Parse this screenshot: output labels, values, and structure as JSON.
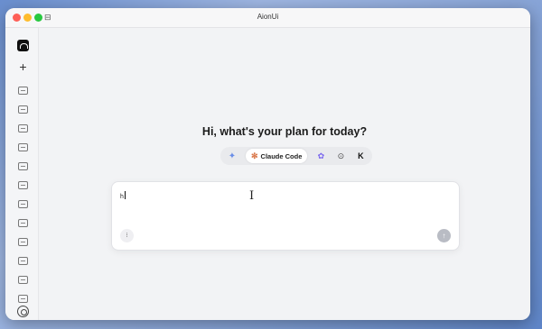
{
  "window": {
    "title": "AionUi"
  },
  "sidebar": {
    "new_chat_icon": "plus-icon",
    "settings_icon": "gear-icon",
    "chat_items": [
      {
        "icon": "chat-icon"
      },
      {
        "icon": "chat-icon"
      },
      {
        "icon": "chat-icon"
      },
      {
        "icon": "chat-icon"
      },
      {
        "icon": "chat-icon"
      },
      {
        "icon": "chat-icon"
      },
      {
        "icon": "chat-icon"
      },
      {
        "icon": "chat-icon"
      },
      {
        "icon": "chat-icon"
      },
      {
        "icon": "chat-icon"
      },
      {
        "icon": "chat-icon"
      },
      {
        "icon": "chat-icon"
      }
    ]
  },
  "main": {
    "headline": "Hi, what's your plan for today?",
    "agents": [
      {
        "icon": "gemini-icon",
        "glyph": "✦"
      },
      {
        "icon": "claude-icon",
        "glyph": "✻",
        "label": "Claude Code",
        "selected": true
      },
      {
        "icon": "purple-agent-icon",
        "glyph": "✿"
      },
      {
        "icon": "codex-icon",
        "glyph": "⊙"
      },
      {
        "icon": "kimi-icon",
        "glyph": "K"
      }
    ],
    "input": {
      "value": "h",
      "attach_glyph": "⁝",
      "send_glyph": "↑"
    }
  },
  "colors": {
    "claude_accent": "#d9774a",
    "close": "#fe5f57",
    "minimize": "#febc2e",
    "maximize": "#28c840"
  }
}
